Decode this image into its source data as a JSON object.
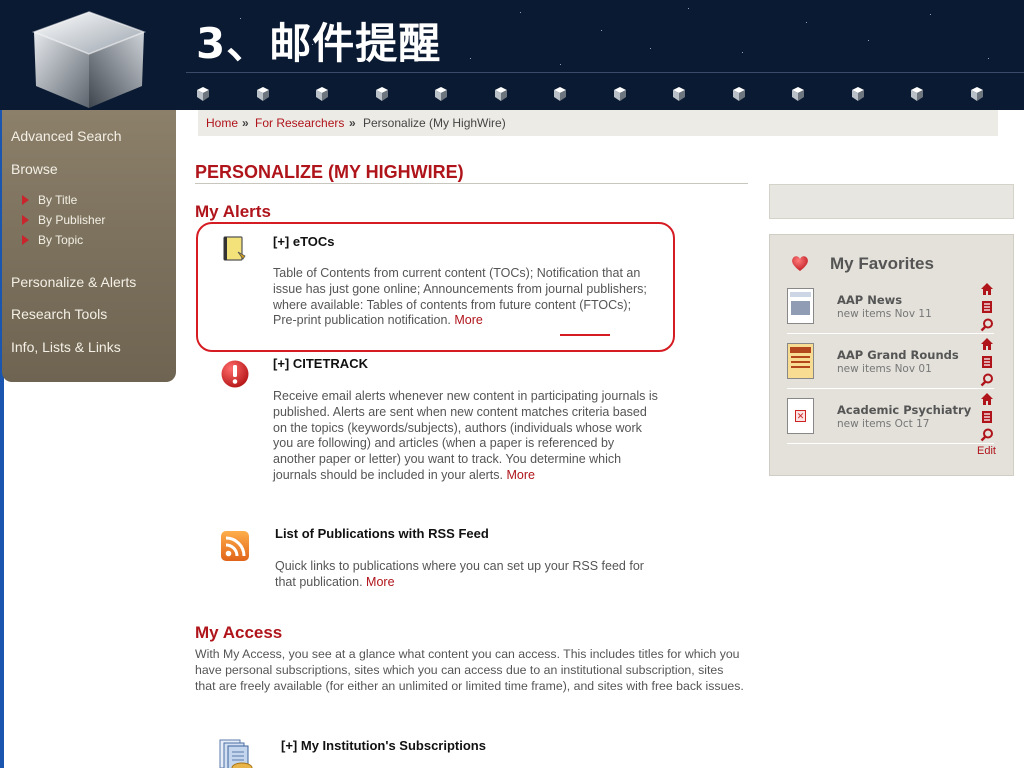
{
  "slide": {
    "title": "3、邮件提醒"
  },
  "sidebar": {
    "items": [
      {
        "label": "Advanced Search"
      },
      {
        "label": "Browse"
      },
      {
        "label": "By Title"
      },
      {
        "label": "By Publisher"
      },
      {
        "label": "By Topic"
      },
      {
        "label": "Personalize & Alerts"
      },
      {
        "label": "Research Tools"
      },
      {
        "label": "Info, Lists & Links"
      }
    ]
  },
  "breadcrumb": {
    "home": "Home",
    "sep": "»",
    "researchers": "For Researchers",
    "current": "Personalize (My HighWire)"
  },
  "page": {
    "heading": "PERSONALIZE (MY HIGHWIRE)"
  },
  "alerts": {
    "heading": "My Alerts",
    "items": [
      {
        "title": "[+] eTOCs",
        "desc": "Table of Contents from current content (TOCs); Notification that an issue has just gone online; Announcements from journal publishers; where available: Tables of contents from future content (FTOCs); Pre-print publication notification.",
        "more": "More"
      },
      {
        "title": "[+] CITETRACK",
        "desc": "Receive email alerts whenever new content in participating journals is published. Alerts are sent when new content matches criteria based on the topics (keywords/subjects), authors (individuals whose work you are following) and articles (when a paper is referenced by another paper or letter) you want to track. You determine which journals should be included in your alerts.",
        "more": "More"
      },
      {
        "title": "List of Publications with RSS Feed",
        "desc": "Quick links to publications where you can set up your RSS feed for that publication.",
        "more": "More"
      }
    ]
  },
  "access": {
    "heading": "My Access",
    "desc": "With My Access, you see at a glance what content you can access. This includes titles for which you have personal subscriptions, sites which you can access due to an institutional subscription, sites that are freely available (for either an unlimited or limited time frame), and sites with free back issues.",
    "item_title": "[+] My Institution's Subscriptions"
  },
  "favorites": {
    "title": "My Favorites",
    "items": [
      {
        "name": "AAP News",
        "sub": "new items Nov 11"
      },
      {
        "name": "AAP Grand Rounds",
        "sub": "new items Nov 01"
      },
      {
        "name": "Academic Psychiatry",
        "sub": "new items Oct 17"
      }
    ],
    "edit": "Edit"
  },
  "colors": {
    "accent_red": "#b0141b",
    "highlight_red": "#d61c23",
    "sidebar": "#7d725e",
    "header_bg": "#0b1a33"
  }
}
